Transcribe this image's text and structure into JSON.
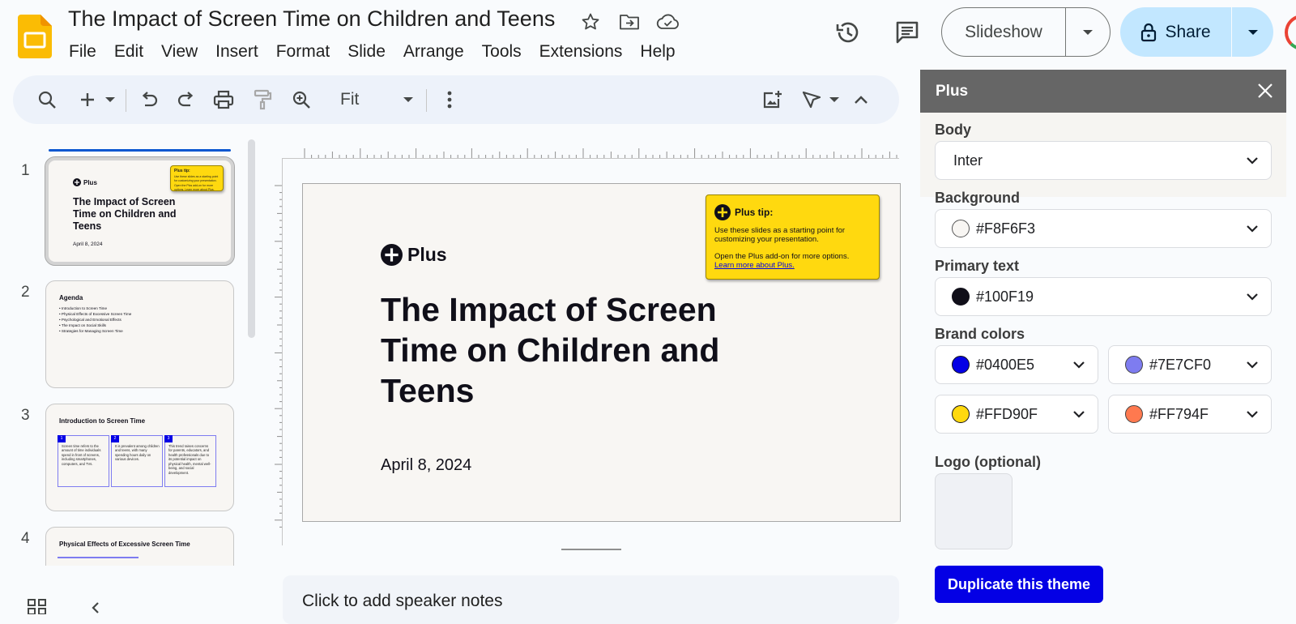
{
  "app": {
    "doc_title": "The Impact of Screen Time on Children and Teens",
    "icon": "slides-app-icon",
    "menu": [
      "File",
      "Edit",
      "View",
      "Insert",
      "Format",
      "Slide",
      "Arrange",
      "Tools",
      "Extensions",
      "Help"
    ],
    "slideshow_label": "Slideshow",
    "share_label": "Share"
  },
  "toolbar": {
    "zoom": "Fit"
  },
  "filmstrip": {
    "slides": [
      {
        "number": "1",
        "logo": "Plus",
        "tip_title": "Plus tip:",
        "tip_body_1": "Use these slides as a starting point for customizing your presentation.",
        "tip_body_2": "Open the Plus add-on for more options. Learn more about Plus.",
        "title": "The Impact of Screen Time on Children and Teens",
        "date": "April 8, 2024"
      },
      {
        "number": "2",
        "title": "Agenda",
        "items": [
          "Introduction to Screen Time",
          "Physical Effects of Excessive Screen Time",
          "Psychological and Emotional Effects",
          "The Impact on Social Skills",
          "Strategies for Managing Screen Time"
        ]
      },
      {
        "number": "3",
        "title": "Introduction to Screen Time",
        "cards": [
          {
            "num": "1",
            "text": "Screen time refers to the amount of time individuals spend in front of screens, including smartphones, computers, and TVs."
          },
          {
            "num": "2",
            "text": "It is prevalent among children and teens, with many spending hours daily on various devices."
          },
          {
            "num": "3",
            "text": "This trend raises concerns for parents, educators, and health professionals due to its potential impact on physical health, mental well-being, and social development."
          }
        ]
      },
      {
        "number": "4",
        "title": "Physical Effects of Excessive Screen Time"
      }
    ]
  },
  "slide": {
    "logo": "Plus",
    "tip": {
      "title": "Plus tip:",
      "line1": "Use these slides as a starting point for",
      "line2": "customizing your presentation.",
      "line3": "Open the Plus add-on for more options.",
      "link": "Learn more about Plus."
    },
    "title_lines": [
      "The Impact of Screen",
      "Time on Children and",
      "Teens"
    ],
    "date": "April 8, 2024"
  },
  "notes": {
    "placeholder": "Click to add speaker notes"
  },
  "panel": {
    "title": "Plus",
    "body_label": "Body",
    "body_font": "Inter",
    "background_label": "Background",
    "background": "#F8F6F3",
    "primary_text_label": "Primary text",
    "primary_text": "#100F19",
    "brand_label": "Brand colors",
    "brand_colors": [
      "#0400E5",
      "#7E7CF0",
      "#FFD90F",
      "#FF794F"
    ],
    "logo_label": "Logo (optional)",
    "duplicate_label": "Duplicate this theme"
  }
}
